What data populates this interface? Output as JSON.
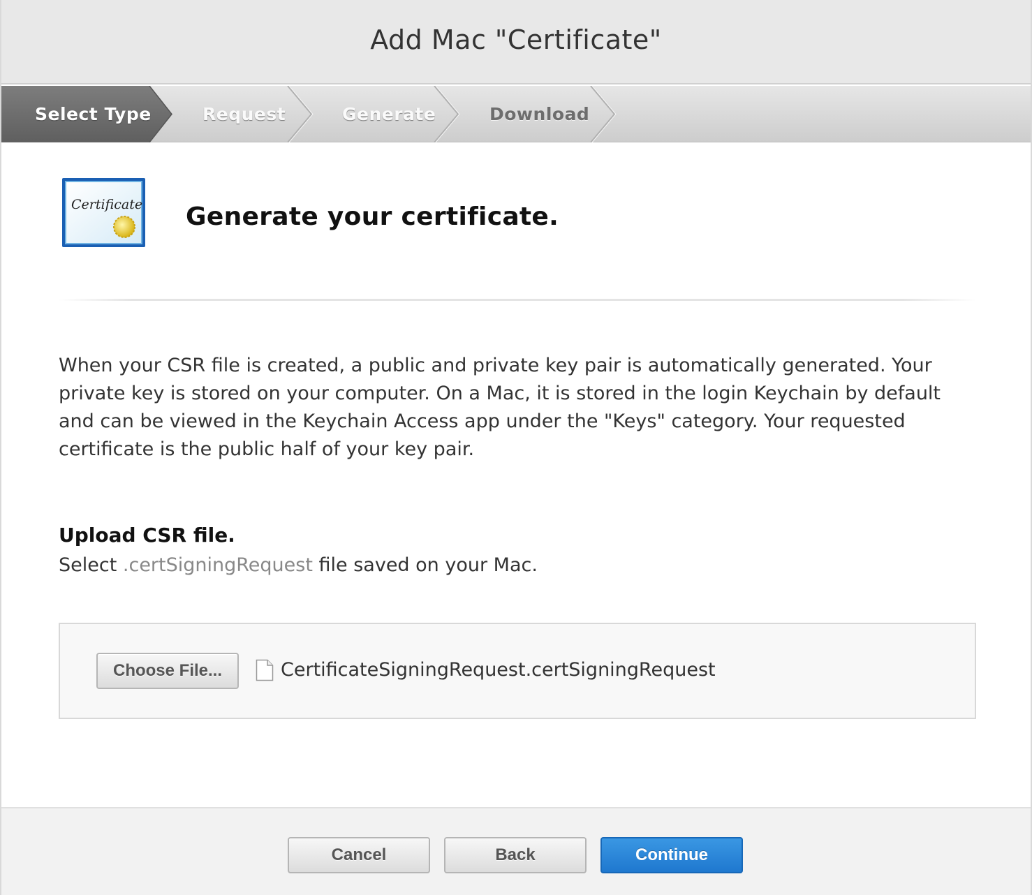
{
  "window": {
    "title": "Add Mac \"Certificate\""
  },
  "steps": [
    {
      "label": "Select Type",
      "state": "active"
    },
    {
      "label": "Request",
      "state": "inactive"
    },
    {
      "label": "Generate",
      "state": "inactive"
    },
    {
      "label": "Download",
      "state": "inactive"
    }
  ],
  "main": {
    "icon": "certificate-icon",
    "icon_text": "Certificate",
    "heading": "Generate your certificate.",
    "description": "When your CSR file is created, a public and private key pair is automatically generated. Your private key is stored on your computer. On a Mac, it is stored in the login Keychain by default and can be viewed in the Keychain Access app under the \"Keys\" category. Your requested certificate is the public half of your key pair.",
    "upload": {
      "title": "Upload CSR file.",
      "sub_prefix": "Select ",
      "sub_ext": ".certSigningRequest",
      "sub_suffix": " file saved on your Mac.",
      "choose_label": "Choose File...",
      "file_name": "CertificateSigningRequest.certSigningRequest"
    }
  },
  "footer": {
    "cancel_label": "Cancel",
    "back_label": "Back",
    "continue_label": "Continue"
  },
  "colors": {
    "primary_button": "#2a86d8",
    "active_step": "#6e6e6e"
  }
}
